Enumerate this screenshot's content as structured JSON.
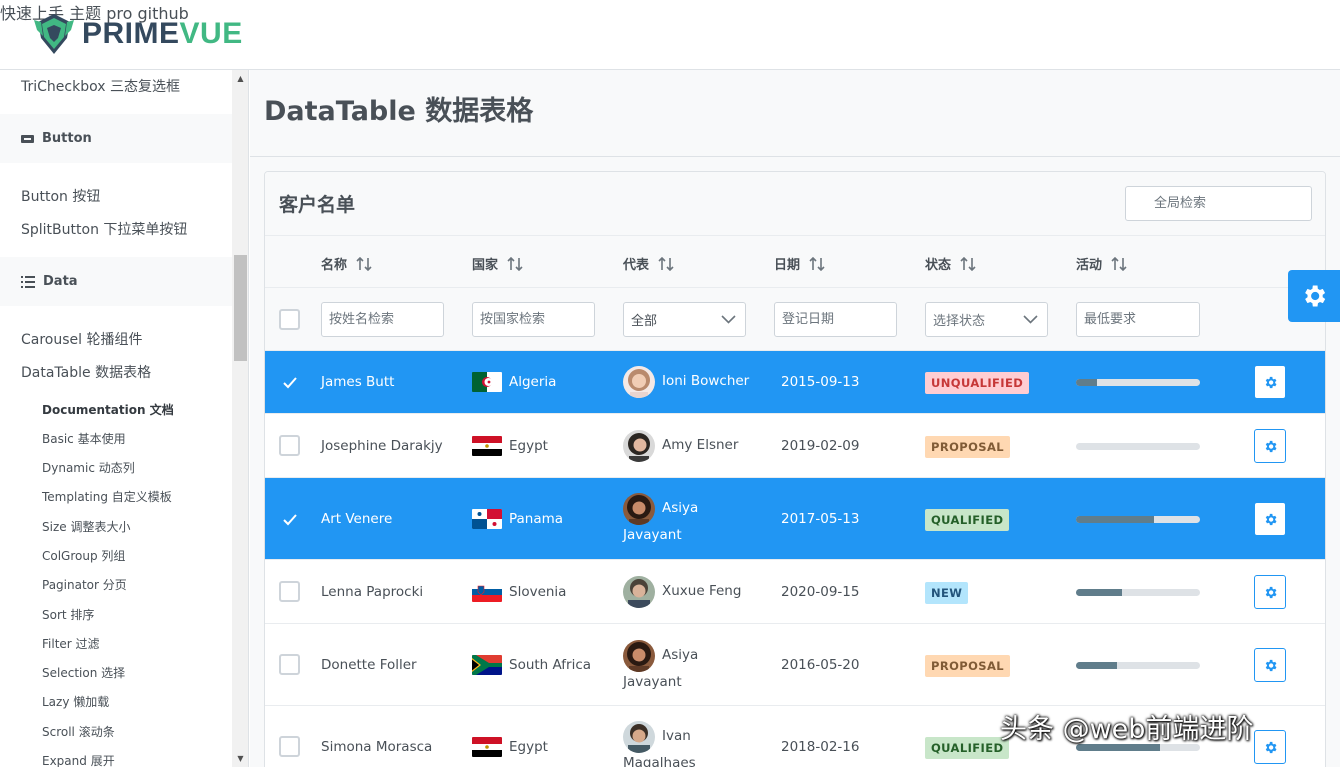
{
  "app": {
    "logo_text_1": "PRIME",
    "logo_text_2": "VUE"
  },
  "topnav": [
    "快速上手",
    "主题",
    "pro",
    "github"
  ],
  "sidebar": {
    "items_top": [
      "TriCheckbox 三态复选框"
    ],
    "categories": [
      "Button",
      "Data"
    ],
    "button_items": [
      "Button 按钮",
      "SplitButton 下拉菜单按钮"
    ],
    "data_items": [
      "Carousel 轮播组件",
      "DataTable 数据表格"
    ],
    "datatable_sub": [
      "Documentation 文档",
      "Basic 基本使用",
      "Dynamic 动态列",
      "Templating 自定义模板",
      "Size 调整表大小",
      "ColGroup 列组",
      "Paginator 分页",
      "Sort 排序",
      "Filter 过滤",
      "Selection 选择",
      "Lazy 懒加载",
      "Scroll 滚动条",
      "Expand 展开"
    ]
  },
  "page": {
    "title": "DataTable 数据表格"
  },
  "table": {
    "caption": "客户名单",
    "global_search_placeholder": "全局检索",
    "columns": [
      "名称",
      "国家",
      "代表",
      "日期",
      "状态",
      "活动"
    ],
    "filters": {
      "name_placeholder": "按姓名检索",
      "country_placeholder": "按国家检索",
      "representative_value": "全部",
      "date_placeholder": "登记日期",
      "status_value": "选择状态",
      "activity_placeholder": "最低要求"
    },
    "rows": [
      {
        "name": "James Butt",
        "country": "Algeria",
        "rep_line1": "Ioni Bowcher",
        "rep_line2": "",
        "date": "2015-09-13",
        "status": "UNQUALIFIED",
        "status_class": "unqualified",
        "activity": 0.17,
        "selected": true
      },
      {
        "name": "Josephine Darakjy",
        "country": "Egypt",
        "rep_line1": "Amy Elsner",
        "rep_line2": "",
        "date": "2019-02-09",
        "status": "PROPOSAL",
        "status_class": "proposal",
        "activity": 0.0,
        "selected": false
      },
      {
        "name": "Art Venere",
        "country": "Panama",
        "rep_line1": "Asiya",
        "rep_line2": "Javayant",
        "date": "2017-05-13",
        "status": "QUALIFIED",
        "status_class": "qualified",
        "activity": 0.63,
        "selected": true
      },
      {
        "name": "Lenna Paprocki",
        "country": "Slovenia",
        "rep_line1": "Xuxue Feng",
        "rep_line2": "",
        "date": "2020-09-15",
        "status": "NEW",
        "status_class": "new",
        "activity": 0.37,
        "selected": false
      },
      {
        "name": "Donette Foller",
        "country": "South Africa",
        "rep_line1": "Asiya",
        "rep_line2": "Javayant",
        "date": "2016-05-20",
        "status": "PROPOSAL",
        "status_class": "proposal",
        "activity": 0.33,
        "selected": false
      },
      {
        "name": "Simona Morasca",
        "country": "Egypt",
        "rep_line1": "Ivan",
        "rep_line2": "Magalhaes",
        "date": "2018-02-16",
        "status": "QUALIFIED",
        "status_class": "qualified",
        "activity": 0.68,
        "selected": false
      }
    ]
  },
  "watermark": "头条 @web前端进阶",
  "colors": {
    "primary": "#2196f3",
    "brand_green": "#41b883",
    "brand_dark": "#34495e",
    "progress": "#607d8b"
  }
}
